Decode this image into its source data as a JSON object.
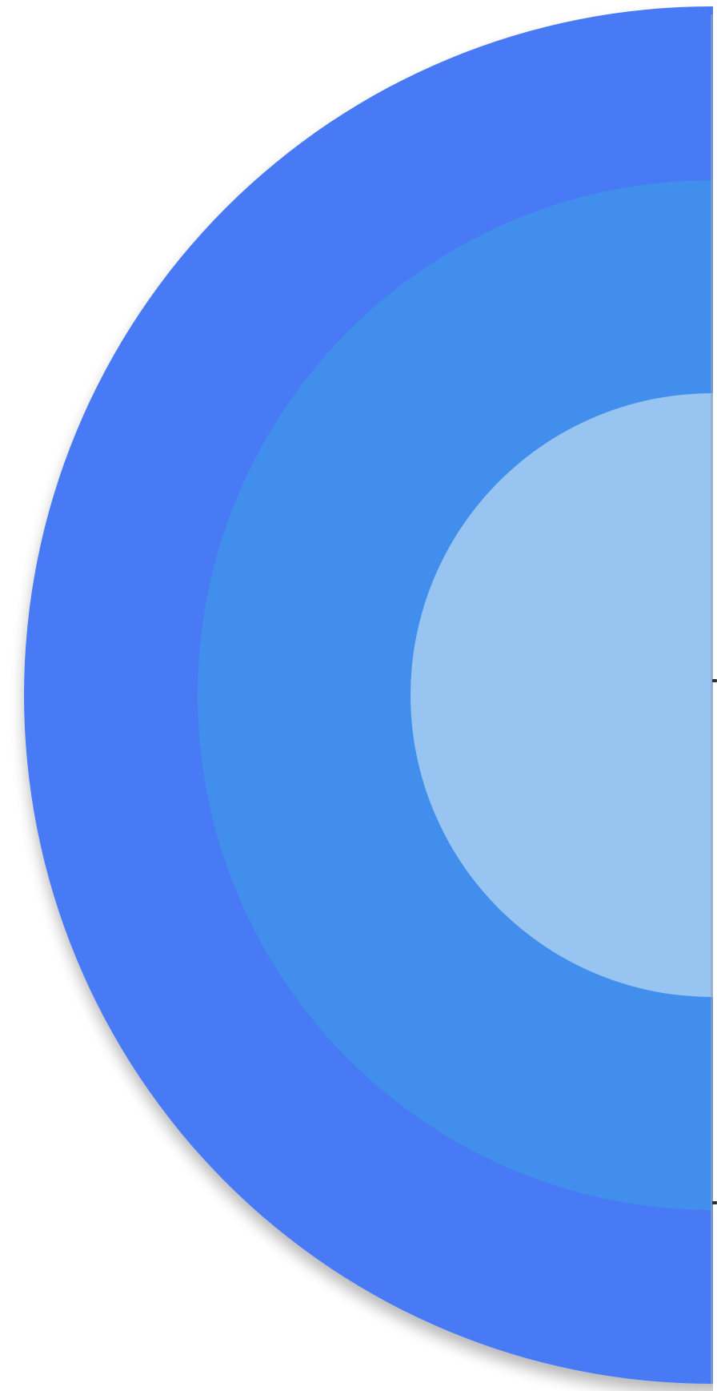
{
  "logo": {
    "icon": "concentric-circles-logo",
    "colors": {
      "outer_ring": "#4a7af5",
      "middle_ring": "#428eec",
      "inner_disc": "#98c4f2",
      "background": "#ffffff",
      "edge_line": "#9aa3b5",
      "tick_marks": "#2b2f3a"
    }
  }
}
